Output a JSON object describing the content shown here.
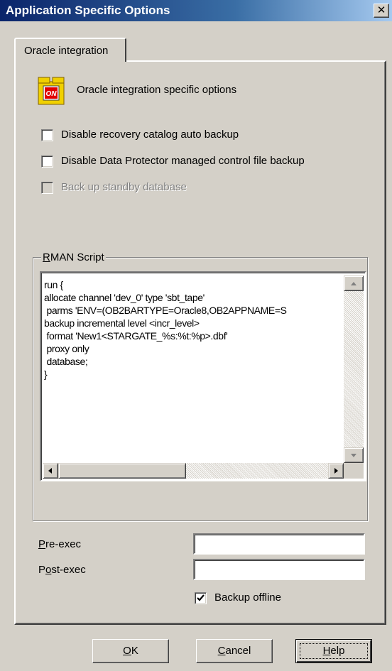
{
  "window": {
    "title": "Application Specific Options",
    "close_glyph": "✕"
  },
  "tabs": [
    {
      "label": "Oracle integration",
      "active": true
    }
  ],
  "section": {
    "heading": "Oracle integration specific options",
    "icon": "oracle-app-icon",
    "icon_text": "ON"
  },
  "options": [
    {
      "label": "Disable recovery catalog auto backup",
      "checked": false,
      "enabled": true
    },
    {
      "label": "Disable Data Protector managed control file backup",
      "checked": false,
      "enabled": true
    },
    {
      "label": "Back up standby database",
      "checked": false,
      "enabled": false
    }
  ],
  "rman": {
    "group_label_mnemonic": "R",
    "group_label_rest": "MAN Script",
    "script": "run {\nallocate channel 'dev_0' type 'sbt_tape'\n parms 'ENV=(OB2BARTYPE=Oracle8,OB2APPNAME=S\nbackup incremental level <incr_level>\n format 'New1<STARGATE_%s:%t:%p>.dbf'\n proxy only\n database;\n}"
  },
  "exec": {
    "pre_mnemonic": "P",
    "pre_rest": "re-exec",
    "pre_value": "",
    "post_mnemonic_prefix": "P",
    "post_mnemonic": "o",
    "post_rest": "st-exec",
    "post_value": ""
  },
  "backup_offline": {
    "label": "Backup offline",
    "checked": true
  },
  "buttons": {
    "ok_mnemonic": "O",
    "ok_rest": "K",
    "cancel_mnemonic": "C",
    "cancel_rest": "ancel",
    "help_mnemonic": "H",
    "help_rest": "elp"
  },
  "colors": {
    "title_start": "#0a246a",
    "title_end": "#a6caf0",
    "face": "#d4d0c8"
  }
}
